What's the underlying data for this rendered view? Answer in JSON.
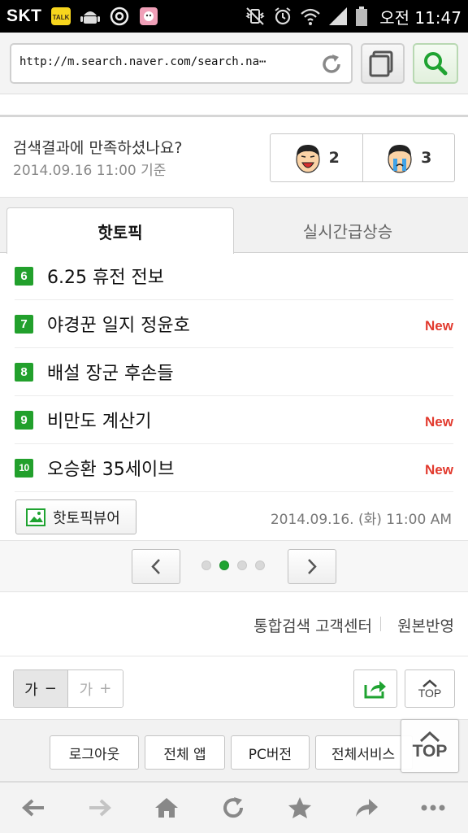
{
  "status_bar": {
    "carrier": "SKT",
    "time": "오전 11:47",
    "icons": [
      "kakaotalk-icon",
      "android-icon",
      "at-icon",
      "app-icon",
      "vibrate-icon",
      "alarm-icon",
      "wifi-icon",
      "signal-icon",
      "battery-icon"
    ]
  },
  "browser": {
    "url": "http://m.search.naver.com/search.na⋯",
    "accent_color": "#1fa331"
  },
  "satisfaction": {
    "question": "검색결과에 만족하셨나요?",
    "date": "2014.09.16 11:00 기준",
    "happy_count": "2",
    "sad_count": "3"
  },
  "tabs": [
    {
      "label": "핫토픽",
      "active": true
    },
    {
      "label": "실시간급상승",
      "active": false
    }
  ],
  "topics": [
    {
      "rank": "6",
      "title": "6.25 휴전 전보",
      "badge": ""
    },
    {
      "rank": "7",
      "title": "야경꾼 일지 정윤호",
      "badge": "New"
    },
    {
      "rank": "8",
      "title": "배설 장군 후손들",
      "badge": ""
    },
    {
      "rank": "9",
      "title": "비만도 계산기",
      "badge": "New"
    },
    {
      "rank": "10",
      "title": "오승환 35세이브",
      "badge": "New"
    }
  ],
  "topic_footer": {
    "viewer_label": "핫토픽뷰어",
    "datetime": "2014.09.16. (화) 11:00 AM"
  },
  "pager": {
    "pages": 4,
    "current": 2
  },
  "footer_links": {
    "customer_center": "통합검색 고객센터",
    "original": "원본반영"
  },
  "tools": {
    "font_small": "가",
    "font_small_sign": "−",
    "font_large": "가",
    "font_large_sign": "+",
    "top_label": "TOP"
  },
  "services": {
    "logout": "로그아웃",
    "all_apps": "전체 앱",
    "pc_version": "PC버전",
    "all_services": "전체서비스"
  },
  "float_top": {
    "label": "TOP"
  },
  "navbar": {
    "icons": [
      "back-icon",
      "forward-icon",
      "home-icon",
      "refresh-icon",
      "bookmark-icon",
      "share-icon",
      "more-icon"
    ]
  }
}
